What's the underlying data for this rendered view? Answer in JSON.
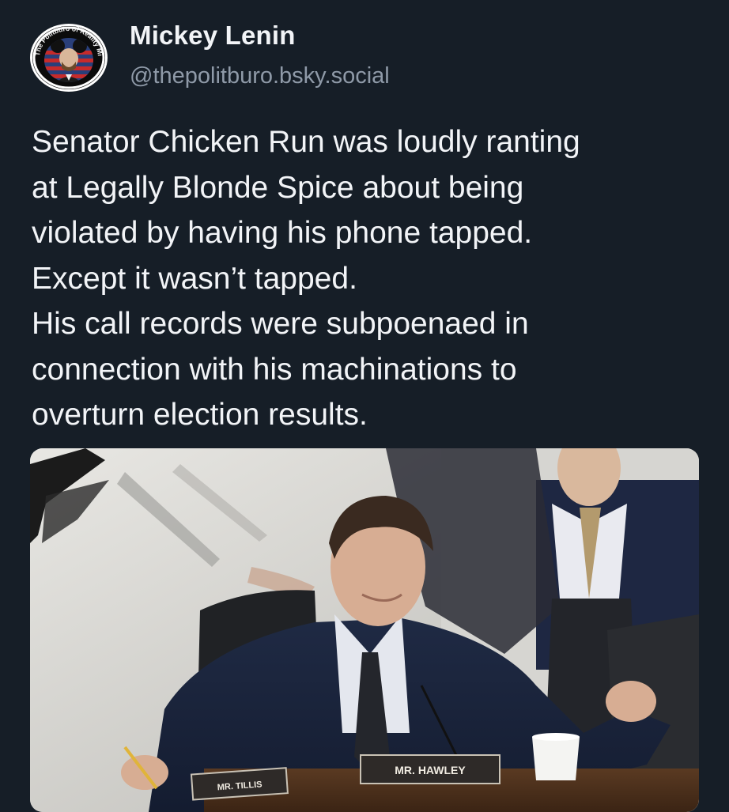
{
  "post": {
    "author": {
      "display_name": "Mickey Lenin",
      "handle": "@thepolitburo.bsky.social",
      "avatar_ring_text": "The Politburo of Reality Mickey"
    },
    "text": "Senator Chicken Run was loudly ranting\nat Legally Blonde Spice about being\nviolated by having his phone tapped.\nExcept it wasn’t tapped.\nHis call records were subpoenaed in\nconnection with his machinations to\noverturn election results.",
    "media": {
      "nameplates": {
        "main": "MR. HAWLEY",
        "left": "MR. TILLIS"
      }
    }
  },
  "colors": {
    "background": "#161e27",
    "text": "#f2f4f7",
    "handle": "#8f9aa8"
  }
}
